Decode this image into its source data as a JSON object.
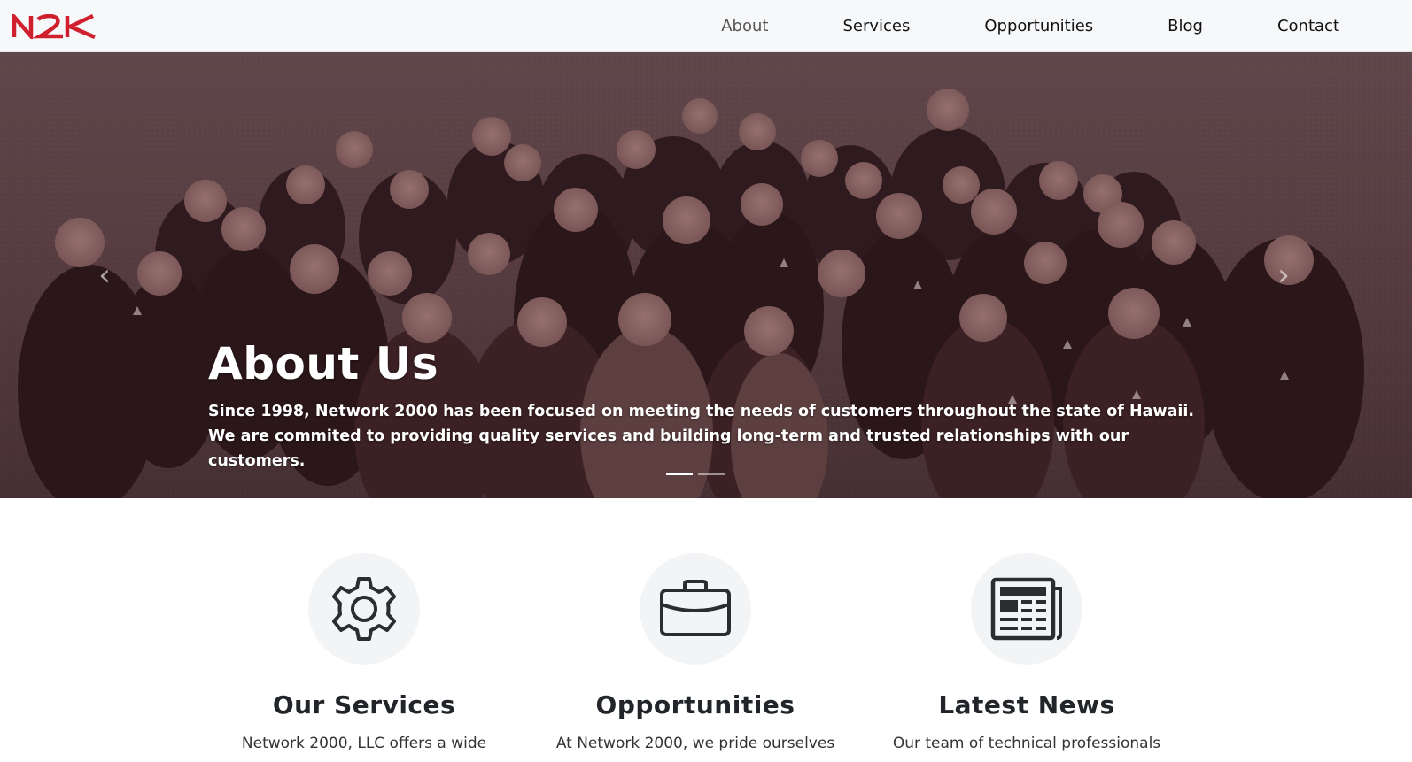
{
  "brand": {
    "logo_text": "N2K",
    "logo_color": "#d0202e"
  },
  "nav": {
    "links": [
      {
        "label": "About",
        "active": true
      },
      {
        "label": "Services"
      },
      {
        "label": "Opportunities"
      },
      {
        "label": "Blog"
      },
      {
        "label": "Contact"
      }
    ]
  },
  "hero": {
    "title": "About Us",
    "text": "Since 1998, Network 2000 has been focused on meeting the needs of customers throughout the state of Hawaii. We are commited to providing quality services and building long-term and trusted relationships with our customers.",
    "prev_icon": "chevron-left-icon",
    "next_icon": "chevron-right-icon",
    "slide_count": 2,
    "active_slide": 1
  },
  "features": [
    {
      "icon": "gear-icon",
      "title": "Our Services",
      "text": "Network 2000, LLC offers a wide"
    },
    {
      "icon": "briefcase-icon",
      "title": "Opportunities",
      "text": "At Network 2000, we pride ourselves"
    },
    {
      "icon": "newspaper-icon",
      "title": "Latest News",
      "text": "Our team of technical professionals"
    }
  ]
}
